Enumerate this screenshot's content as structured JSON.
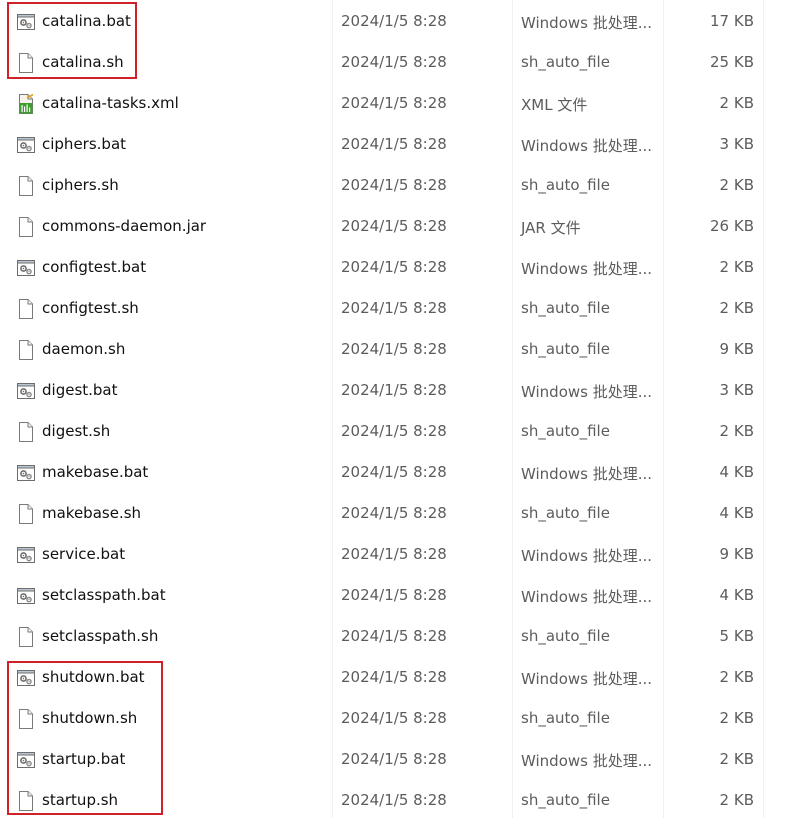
{
  "accent_color": "#d0202a",
  "files": [
    {
      "name": "catalina.bat",
      "date": "2024/1/5 8:28",
      "type": "Windows 批处理...",
      "size": "17 KB",
      "icon": "batch-file-icon"
    },
    {
      "name": "catalina.sh",
      "date": "2024/1/5 8:28",
      "type": "sh_auto_file",
      "size": "25 KB",
      "icon": "blank-file-icon"
    },
    {
      "name": "catalina-tasks.xml",
      "date": "2024/1/5 8:28",
      "type": "XML 文件",
      "size": "2 KB",
      "icon": "xml-file-icon"
    },
    {
      "name": "ciphers.bat",
      "date": "2024/1/5 8:28",
      "type": "Windows 批处理...",
      "size": "3 KB",
      "icon": "batch-file-icon"
    },
    {
      "name": "ciphers.sh",
      "date": "2024/1/5 8:28",
      "type": "sh_auto_file",
      "size": "2 KB",
      "icon": "blank-file-icon"
    },
    {
      "name": "commons-daemon.jar",
      "date": "2024/1/5 8:28",
      "type": "JAR 文件",
      "size": "26 KB",
      "icon": "blank-file-icon"
    },
    {
      "name": "configtest.bat",
      "date": "2024/1/5 8:28",
      "type": "Windows 批处理...",
      "size": "2 KB",
      "icon": "batch-file-icon"
    },
    {
      "name": "configtest.sh",
      "date": "2024/1/5 8:28",
      "type": "sh_auto_file",
      "size": "2 KB",
      "icon": "blank-file-icon"
    },
    {
      "name": "daemon.sh",
      "date": "2024/1/5 8:28",
      "type": "sh_auto_file",
      "size": "9 KB",
      "icon": "blank-file-icon"
    },
    {
      "name": "digest.bat",
      "date": "2024/1/5 8:28",
      "type": "Windows 批处理...",
      "size": "3 KB",
      "icon": "batch-file-icon"
    },
    {
      "name": "digest.sh",
      "date": "2024/1/5 8:28",
      "type": "sh_auto_file",
      "size": "2 KB",
      "icon": "blank-file-icon"
    },
    {
      "name": "makebase.bat",
      "date": "2024/1/5 8:28",
      "type": "Windows 批处理...",
      "size": "4 KB",
      "icon": "batch-file-icon"
    },
    {
      "name": "makebase.sh",
      "date": "2024/1/5 8:28",
      "type": "sh_auto_file",
      "size": "4 KB",
      "icon": "blank-file-icon"
    },
    {
      "name": "service.bat",
      "date": "2024/1/5 8:28",
      "type": "Windows 批处理...",
      "size": "9 KB",
      "icon": "batch-file-icon"
    },
    {
      "name": "setclasspath.bat",
      "date": "2024/1/5 8:28",
      "type": "Windows 批处理...",
      "size": "4 KB",
      "icon": "batch-file-icon"
    },
    {
      "name": "setclasspath.sh",
      "date": "2024/1/5 8:28",
      "type": "sh_auto_file",
      "size": "5 KB",
      "icon": "blank-file-icon"
    },
    {
      "name": "shutdown.bat",
      "date": "2024/1/5 8:28",
      "type": "Windows 批处理...",
      "size": "2 KB",
      "icon": "batch-file-icon"
    },
    {
      "name": "shutdown.sh",
      "date": "2024/1/5 8:28",
      "type": "sh_auto_file",
      "size": "2 KB",
      "icon": "blank-file-icon"
    },
    {
      "name": "startup.bat",
      "date": "2024/1/5 8:28",
      "type": "Windows 批处理...",
      "size": "2 KB",
      "icon": "batch-file-icon"
    },
    {
      "name": "startup.sh",
      "date": "2024/1/5 8:28",
      "type": "sh_auto_file",
      "size": "2 KB",
      "icon": "blank-file-icon"
    }
  ]
}
